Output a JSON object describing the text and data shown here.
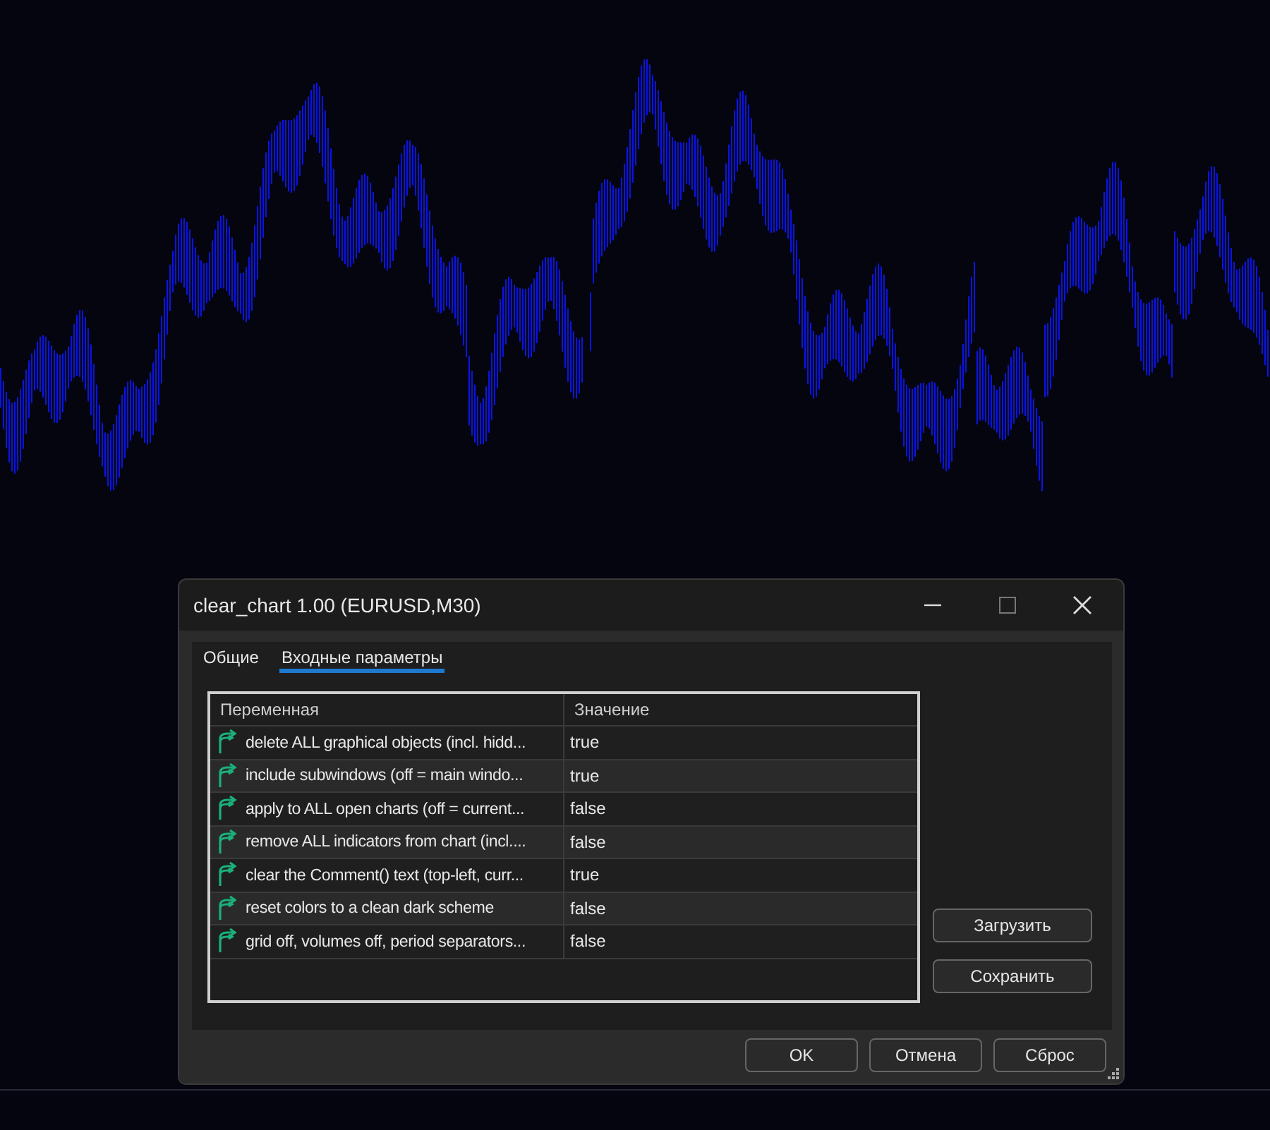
{
  "window": {
    "title": "clear_chart 1.00 (EURUSD,M30)"
  },
  "tabs": [
    {
      "label": "Общие",
      "selected": false
    },
    {
      "label": "Входные параметры",
      "selected": true
    }
  ],
  "table": {
    "columns": [
      "Переменная",
      "Значение"
    ],
    "rows": [
      {
        "name": "delete ALL graphical objects (incl. hidd...",
        "value": "true"
      },
      {
        "name": "include subwindows (off = main windo...",
        "value": "true"
      },
      {
        "name": "apply to ALL open charts (off = current...",
        "value": "false"
      },
      {
        "name": "remove ALL indicators from chart (incl....",
        "value": "false"
      },
      {
        "name": "clear the Comment() text (top-left, curr...",
        "value": "true"
      },
      {
        "name": "reset colors to a clean dark scheme",
        "value": "false"
      },
      {
        "name": "grid off, volumes off, period separators...",
        "value": "false"
      }
    ]
  },
  "side_buttons": [
    "Загрузить",
    "Сохранить"
  ],
  "buttons": [
    "OK",
    "Отмена",
    "Сброс"
  ]
}
